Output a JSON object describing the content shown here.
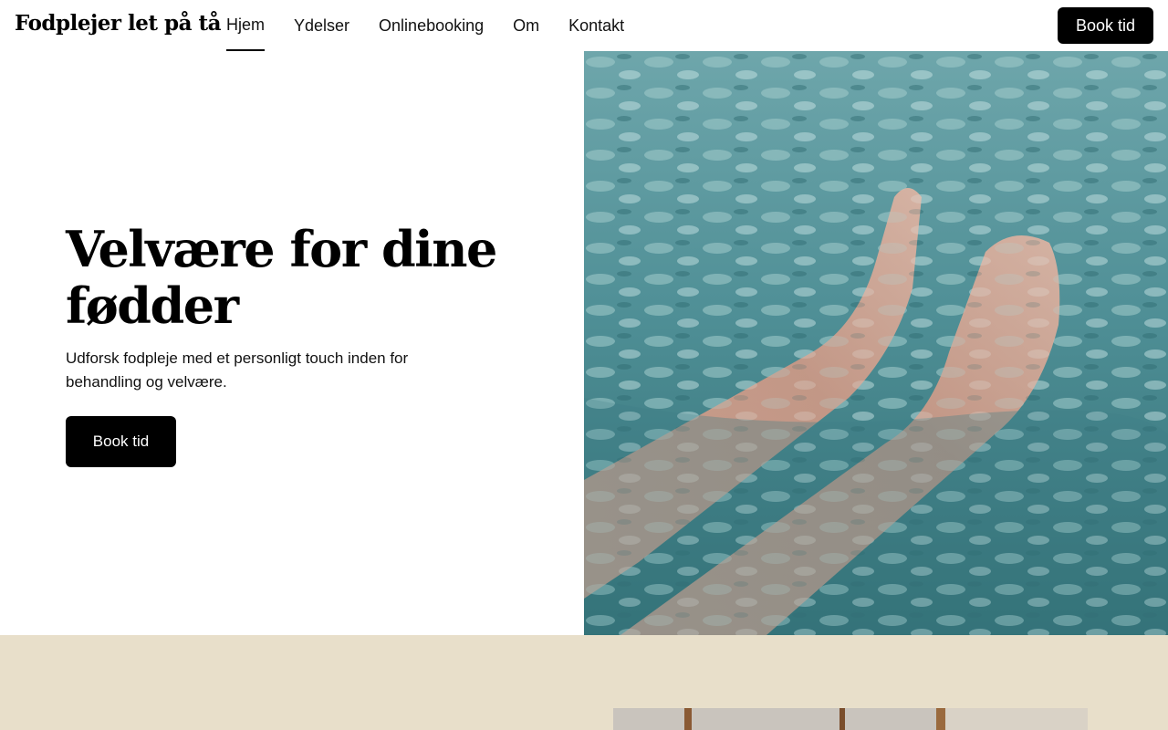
{
  "header": {
    "brand": "Fodplejer let på tå",
    "nav": [
      {
        "label": "Hjem",
        "active": true
      },
      {
        "label": "Ydelser",
        "active": false
      },
      {
        "label": "Onlinebooking",
        "active": false
      },
      {
        "label": "Om",
        "active": false
      },
      {
        "label": "Kontakt",
        "active": false
      }
    ],
    "book_label": "Book tid"
  },
  "hero": {
    "title": "Velvære for dine fødder",
    "subtitle": "Udforsk fodpleje med et personligt touch inden for behandling og velvære.",
    "button_label": "Book tid",
    "image": "feet-in-water-photo"
  },
  "next_section": {
    "background": "#e8dfca",
    "image": "room-interior-photo"
  },
  "colors": {
    "button_bg": "#000000",
    "button_text": "#ffffff",
    "water": "#4f8f96"
  }
}
